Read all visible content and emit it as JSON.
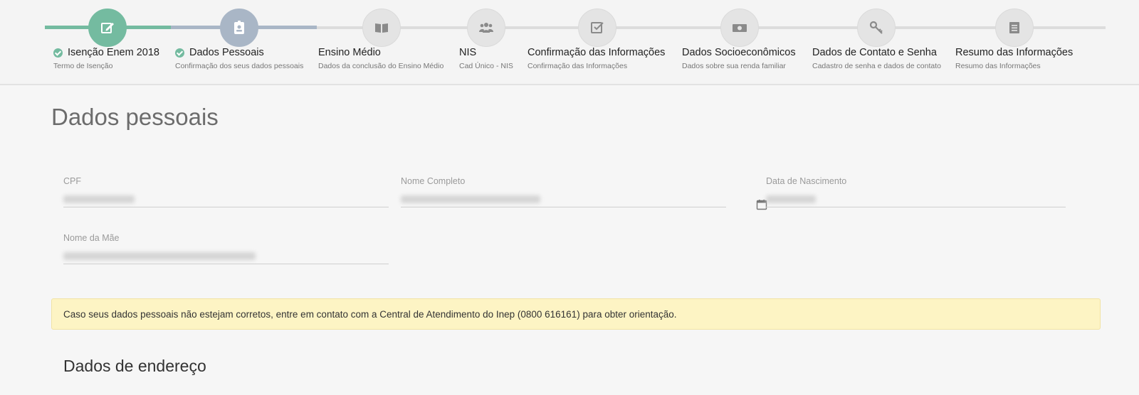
{
  "stepper": {
    "steps": [
      {
        "title": "Isenção Enem 2018",
        "subtitle": "Termo de Isenção",
        "status": "done",
        "icon": "edit-icon"
      },
      {
        "title": "Dados Pessoais",
        "subtitle": "Confirmação dos seus dados pessoais",
        "status": "current",
        "icon": "id-badge-icon"
      },
      {
        "title": "Ensino Médio",
        "subtitle": "Dados da conclusão do Ensino Médio",
        "status": "pending",
        "icon": "book-icon"
      },
      {
        "title": "NIS",
        "subtitle": "Cad Único - NIS",
        "status": "pending",
        "icon": "users-icon"
      },
      {
        "title": "Confirmação das Informações",
        "subtitle": "Confirmação das Informações",
        "status": "pending",
        "icon": "checkbox-icon"
      },
      {
        "title": "Dados Socioeconômicos",
        "subtitle": "Dados sobre sua renda familiar",
        "status": "pending",
        "icon": "money-icon"
      },
      {
        "title": "Dados de Contato e Senha",
        "subtitle": "Cadastro de senha e dados de contato",
        "status": "pending",
        "icon": "key-icon"
      },
      {
        "title": "Resumo das Informações",
        "subtitle": "Resumo das Informações",
        "status": "pending",
        "icon": "list-icon"
      }
    ]
  },
  "page": {
    "title": "Dados pessoais",
    "fields": {
      "cpf": {
        "label": "CPF"
      },
      "nome": {
        "label": "Nome Completo"
      },
      "nascimento": {
        "label": "Data de Nascimento"
      },
      "mae": {
        "label": "Nome da Mãe"
      }
    },
    "alert": "Caso seus dados pessoais não estejam corretos, entre em contato com a Central de Atendimento do Inep (0800 616161) para obter orientação.",
    "section_title": "Dados de endereço"
  },
  "colors": {
    "done": "#74bba0",
    "current": "#a9b6c6",
    "pending": "#e4e4e4",
    "alert_bg": "#fdf4c4"
  }
}
